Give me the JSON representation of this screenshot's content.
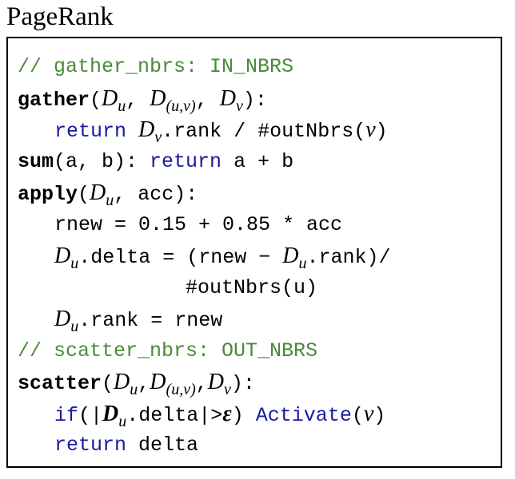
{
  "title": "PageRank",
  "code": {
    "l1": {
      "comment": "// gather_nbrs: IN_NBRS"
    },
    "l2": {
      "fn": "gather",
      "open": "(",
      "d1": "D",
      "s1": "u",
      "c1": ", ",
      "d2": "D",
      "s2": "(u,v)",
      "c2": ", ",
      "d3": "D",
      "s3": "v",
      "close": "):"
    },
    "l3": {
      "kw": "return",
      "sp": " ",
      "d": "D",
      "s": "v",
      "rest": ".rank / #outNbrs(",
      "v": "v",
      "close": ")"
    },
    "l4": {
      "fn": "sum",
      "args": "(a, b): ",
      "kw": "return",
      "rest": " a + b"
    },
    "l5": {
      "fn": "apply",
      "open": "(",
      "d": "D",
      "s": "u",
      "rest": ", acc):"
    },
    "l6": {
      "text": "rnew = 0.15 + 0.85 * acc"
    },
    "l7": {
      "d1": "D",
      "s1": "u",
      "mid": ".delta = (rnew − ",
      "d2": "D",
      "s2": "u",
      "end": ".rank)/"
    },
    "l8": {
      "text": "#outNbrs(u)"
    },
    "l9": {
      "d": "D",
      "s": "u",
      "rest": ".rank = rnew"
    },
    "l10": {
      "comment": "// scatter_nbrs: OUT_NBRS"
    },
    "l11": {
      "fn": "scatter",
      "open": "(",
      "d1": "D",
      "s1": "u",
      "c1": ",",
      "d2": "D",
      "s2": "(u,v)",
      "c2": ",",
      "d3": "D",
      "s3": "v",
      "close": "):"
    },
    "l12": {
      "kw1": "if",
      "a": "(|",
      "d": "D",
      "s": "u",
      "mid": ".delta|>",
      "eps": "ε",
      "b": ") ",
      "kw2": "Activate",
      "open": "(",
      "v": "v",
      "close": ")"
    },
    "l13": {
      "kw": "return",
      "rest": " delta"
    }
  }
}
